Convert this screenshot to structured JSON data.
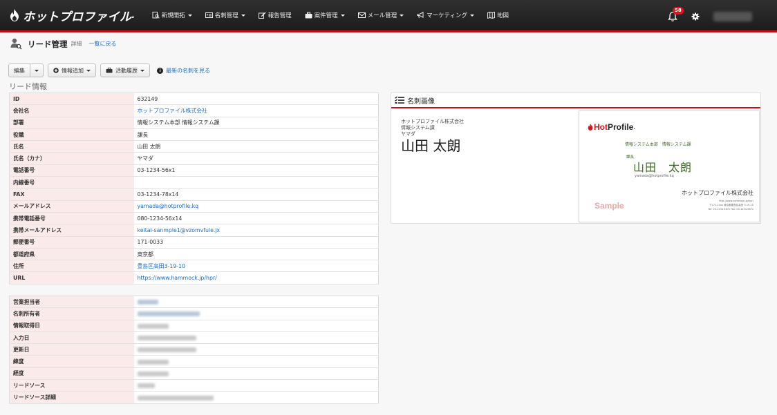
{
  "brand": {
    "name": "ホットプロファイル",
    "mark": "."
  },
  "nav": [
    {
      "label": "新規開拓",
      "icon": "document-search-icon",
      "caret": true
    },
    {
      "label": "名刺管理",
      "icon": "id-card-icon",
      "caret": true
    },
    {
      "label": "報告管理",
      "icon": "edit-icon",
      "caret": false
    },
    {
      "label": "案件管理",
      "icon": "briefcase-icon",
      "caret": true
    },
    {
      "label": "メール管理",
      "icon": "envelope-icon",
      "caret": true
    },
    {
      "label": "マーケティング",
      "icon": "megaphone-icon",
      "caret": true
    },
    {
      "label": "地図",
      "icon": "map-icon",
      "caret": false
    }
  ],
  "notifications": {
    "count": "58"
  },
  "page": {
    "title": "リード管理",
    "subtitle": "詳細",
    "back_link": "一覧に戻る"
  },
  "toolbar": {
    "edit": "編集",
    "add_info": "情報追加",
    "activity": "活動履歴",
    "latest_card": "最新の名刺を見る"
  },
  "section_label": "リード情報",
  "lead_info": [
    {
      "key": "ID",
      "value": "632149",
      "link": false
    },
    {
      "key": "会社名",
      "value": "ホットプロファイル株式会社",
      "link": true
    },
    {
      "key": "部署",
      "value": "情報システム本部 情報システム課",
      "link": false
    },
    {
      "key": "役職",
      "value": "課長",
      "link": false
    },
    {
      "key": "氏名",
      "value": "山田 太朗",
      "link": false
    },
    {
      "key": "氏名（カナ）",
      "value": "ヤマダ",
      "link": false
    },
    {
      "key": "電話番号",
      "value": "03-1234-56x1",
      "link": false
    },
    {
      "key": "内線番号",
      "value": "",
      "link": false
    },
    {
      "key": "FAX",
      "value": "03-1234-78x14",
      "link": false
    },
    {
      "key": "メールアドレス",
      "value": "yamada@hotprofile.kq",
      "link": true
    },
    {
      "key": "携帯電話番号",
      "value": "080-1234-56x14",
      "link": false
    },
    {
      "key": "携帯メールアドレス",
      "value": "keitai-sanmple1@vzomvfule.jx",
      "link": true
    },
    {
      "key": "郵便番号",
      "value": "171-0033",
      "link": false
    },
    {
      "key": "都道府県",
      "value": "東京都",
      "link": false
    },
    {
      "key": "住所",
      "value": "豊島区高田3-19-10",
      "link": true
    },
    {
      "key": "URL",
      "value": "https://www.hammock.jp/hpr/",
      "link": true
    }
  ],
  "owner_info": [
    {
      "key": "営業担当者",
      "blur": "link"
    },
    {
      "key": "名刺所有者",
      "blur": "link"
    },
    {
      "key": "情報取得日",
      "blur": "grey"
    },
    {
      "key": "入力日",
      "blur": "grey"
    },
    {
      "key": "更新日",
      "blur": "grey"
    },
    {
      "key": "緯度",
      "blur": "grey"
    },
    {
      "key": "経度",
      "blur": "grey"
    },
    {
      "key": "リードソース",
      "blur": "grey"
    },
    {
      "key": "リードソース詳細",
      "blur": "grey"
    }
  ],
  "card_panel": {
    "title": "名刺画像",
    "ocr_company": "ホットプロファイル株式会社",
    "ocr_dept": "情報システム課",
    "ocr_kana": "ヤマダ",
    "ocr_name": "山田 太朗"
  },
  "business_card": {
    "logo_hot": "Hot",
    "logo_profile": "Profile",
    "logo_dot": ".",
    "dept": "情報システム本部　情報システム課",
    "title": "課長",
    "name": "山田　太朗",
    "email": "yamada@hotprofile.kq",
    "company": "ホットプロファイル株式会社",
    "sample": "Sample",
    "url": "http://www.hammock.jp/hpr/",
    "address": "〒171-14xx 東京都豊島区高田 3-19-10",
    "phone": "Tel: 03-1234-567x  Fax: 03-1234-567x"
  },
  "colors": {
    "accent": "#c4121c",
    "link": "#1e6dc0",
    "key_bg": "#fbeaea"
  }
}
